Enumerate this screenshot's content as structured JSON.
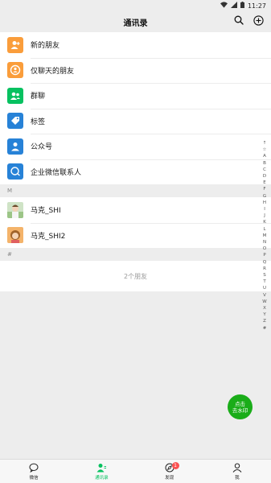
{
  "status_bar": {
    "time": "11:27"
  },
  "header": {
    "title": "通讯录"
  },
  "func_items": [
    {
      "label": "新的朋友",
      "icon": "add-friend-icon",
      "color": "#fa9d3b"
    },
    {
      "label": "仅聊天的朋友",
      "icon": "chat-only-friend-icon",
      "color": "#fa9d3b"
    },
    {
      "label": "群聊",
      "icon": "group-chat-icon",
      "color": "#07c160"
    },
    {
      "label": "标签",
      "icon": "tag-icon",
      "color": "#2782d7"
    },
    {
      "label": "公众号",
      "icon": "official-account-icon",
      "color": "#2782d7"
    },
    {
      "label": "企业微信联系人",
      "icon": "wecom-contact-icon",
      "color": "#2782d7"
    }
  ],
  "sections": [
    {
      "letter": "M",
      "contacts": [
        {
          "name": "马克_SHI"
        },
        {
          "name": "马克_SHI2"
        }
      ]
    },
    {
      "letter": "#",
      "contacts": []
    }
  ],
  "friend_count": "2个朋友",
  "index_letters": [
    "↑",
    "☆",
    "A",
    "B",
    "C",
    "D",
    "E",
    "F",
    "G",
    "H",
    "I",
    "J",
    "K",
    "L",
    "M",
    "N",
    "O",
    "P",
    "Q",
    "R",
    "S",
    "T",
    "U",
    "V",
    "W",
    "X",
    "Y",
    "Z",
    "#"
  ],
  "watermark_button": {
    "line1": "点击",
    "line2": "去水印"
  },
  "tabs": [
    {
      "label": "微信",
      "icon": "chat-bubble-icon",
      "active": false
    },
    {
      "label": "通讯录",
      "icon": "contacts-icon",
      "active": true
    },
    {
      "label": "发现",
      "icon": "compass-icon",
      "active": false,
      "badge": "1"
    },
    {
      "label": "我",
      "icon": "person-icon",
      "active": false
    }
  ]
}
